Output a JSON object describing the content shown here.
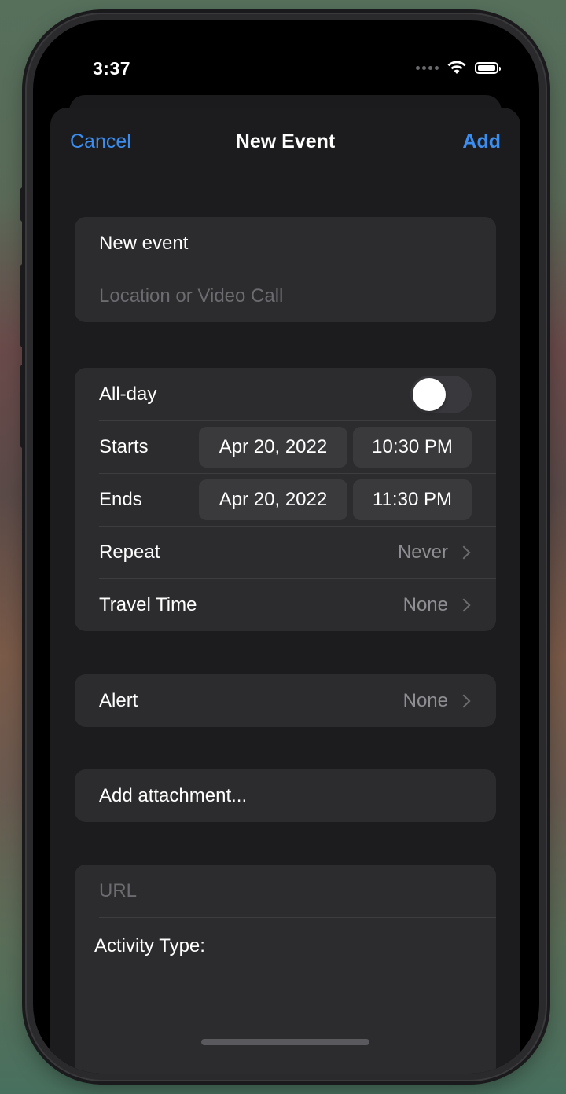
{
  "status_bar": {
    "time": "3:37",
    "wifi_icon": "wifi-icon",
    "battery_icon": "battery-icon"
  },
  "nav": {
    "cancel_label": "Cancel",
    "title": "New Event",
    "add_label": "Add"
  },
  "title_group": {
    "title_value": "New event",
    "location_placeholder": "Location or Video Call"
  },
  "time_group": {
    "allday_label": "All-day",
    "allday_on": false,
    "starts_label": "Starts",
    "starts_date": "Apr 20, 2022",
    "starts_time": "10:30 PM",
    "ends_label": "Ends",
    "ends_date": "Apr 20, 2022",
    "ends_time": "11:30 PM",
    "repeat_label": "Repeat",
    "repeat_value": "Never",
    "travel_label": "Travel Time",
    "travel_value": "None"
  },
  "alert_group": {
    "alert_label": "Alert",
    "alert_value": "None"
  },
  "attachment_group": {
    "label": "Add attachment..."
  },
  "extra_group": {
    "url_placeholder": "URL",
    "activity_label": "Activity Type:"
  },
  "colors": {
    "accent": "#3b8ef0",
    "sheet": "#1c1c1e",
    "group": "#2c2c2e"
  }
}
